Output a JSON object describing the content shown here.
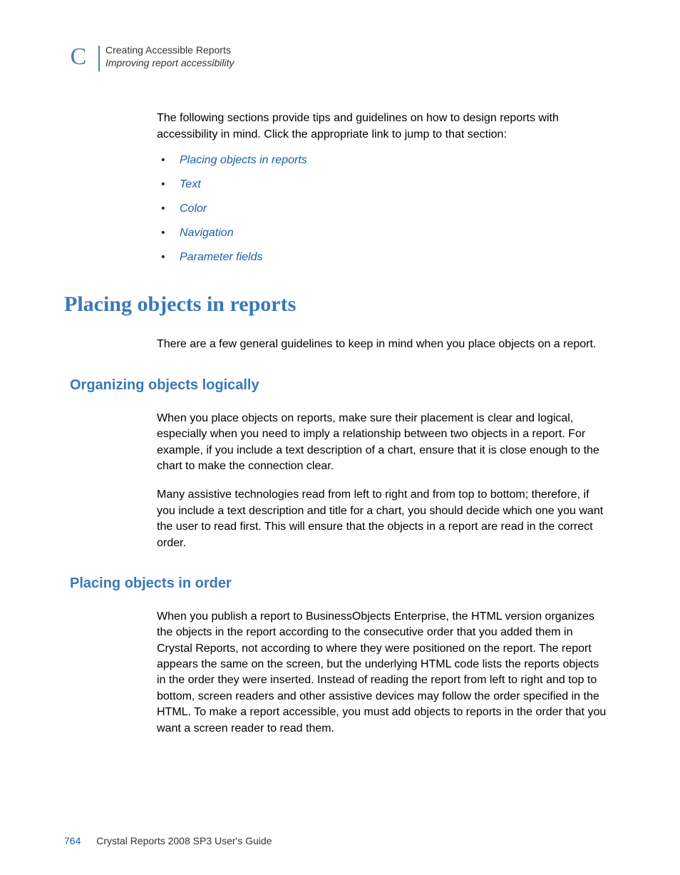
{
  "header": {
    "appendix_letter": "C",
    "line1": "Creating Accessible Reports",
    "line2": "Improving report accessibility"
  },
  "intro": "The following sections provide tips and guidelines on how to design reports with accessibility in mind. Click the appropriate link to jump to that section:",
  "links": [
    "Placing objects in reports",
    "Text",
    "Color",
    "Navigation",
    "Parameter fields"
  ],
  "section1": {
    "title": "Placing objects in reports",
    "para": "There are a few general guidelines to keep in mind when you place objects on a report."
  },
  "sub1": {
    "title": "Organizing objects logically",
    "para1": "When you place objects on reports, make sure their placement is clear and logical, especially when you need to imply a relationship between two objects in a report. For example, if you include a text description of a chart, ensure that it is close enough to the chart to make the connection clear.",
    "para2": "Many assistive technologies read from left to right and from top to bottom; therefore, if you include a text description and title for a chart, you should decide which one you want the user to read first. This will ensure that the objects in a report are read in the correct order."
  },
  "sub2": {
    "title": "Placing objects in order",
    "para1": "When you publish a report to BusinessObjects Enterprise, the HTML version organizes the objects in the report according to the consecutive order that you added them in Crystal Reports, not according to where they were positioned on the report. The report appears the same on the screen, but the underlying HTML code lists the reports objects in the order they were inserted. Instead of reading the report from left to right and top to bottom, screen readers and other assistive devices may follow the order specified in the HTML. To make a report accessible, you must add objects to reports in the order that you want a screen reader to read them."
  },
  "footer": {
    "page": "764",
    "title": "Crystal Reports 2008 SP3 User's Guide"
  }
}
